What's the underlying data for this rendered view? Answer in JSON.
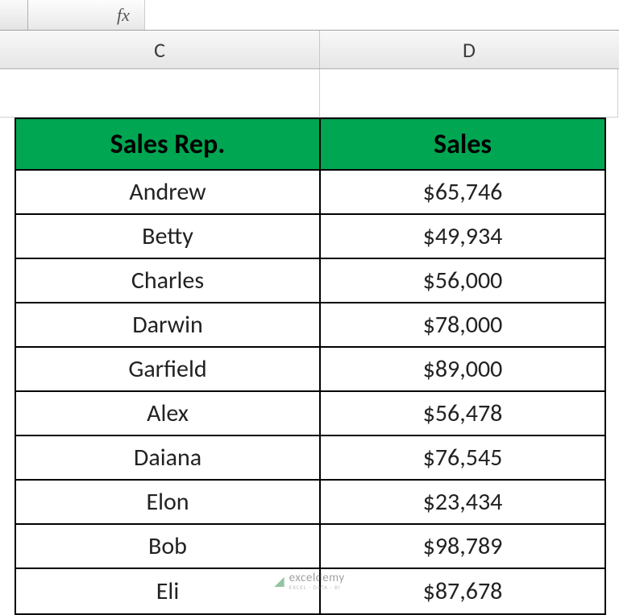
{
  "formula_bar": {
    "fx_label": "fx",
    "formula_value": ""
  },
  "columns": {
    "c_label": "C",
    "d_label": "D"
  },
  "table": {
    "headers": {
      "col1": "Sales Rep.",
      "col2": "Sales"
    },
    "rows": [
      {
        "rep": "Andrew",
        "sales": "$65,746"
      },
      {
        "rep": "Betty",
        "sales": "$49,934"
      },
      {
        "rep": "Charles",
        "sales": "$56,000"
      },
      {
        "rep": "Darwin",
        "sales": "$78,000"
      },
      {
        "rep": "Garfield",
        "sales": "$89,000"
      },
      {
        "rep": "Alex",
        "sales": "$56,478"
      },
      {
        "rep": "Daiana",
        "sales": "$76,545"
      },
      {
        "rep": "Elon",
        "sales": "$23,434"
      },
      {
        "rep": "Bob",
        "sales": "$98,789"
      },
      {
        "rep": "Eli",
        "sales": "$87,678"
      }
    ]
  },
  "watermark": {
    "brand": "exceldemy",
    "sub": "EXCEL · DATA · BI"
  }
}
